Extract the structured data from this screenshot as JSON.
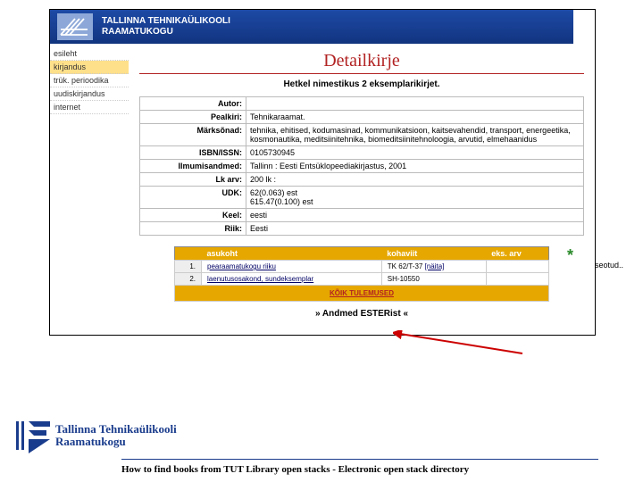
{
  "header": {
    "line1": "TALLINNA TEHNIKAÜLIKOOLI",
    "line2": "RAAMATUKOGU"
  },
  "nav": {
    "items": [
      {
        "label": "esileht",
        "hl": false
      },
      {
        "label": "kirjandus",
        "hl": true
      },
      {
        "label": "trük. perioodika",
        "hl": false
      },
      {
        "label": "uudiskirjandus",
        "hl": false
      },
      {
        "label": "internet",
        "hl": false
      }
    ]
  },
  "page": {
    "title": "Detailkirje",
    "subtitle": "Hetkel nimestikus 2 eksemplarikirjet."
  },
  "detail": {
    "rows": [
      {
        "label": "Autor:",
        "value": ""
      },
      {
        "label": "Pealkiri:",
        "value": "Tehnikaraamat."
      },
      {
        "label": "Märksõnad:",
        "value": "tehnika, ehitised, kodumasinad, kommunikatsioon, kaitsevahendid, transport, energeetika, kosmonautika, meditsiinitehnika, biomeditsiinitehnoloogia, arvutid, elmehaanidus"
      },
      {
        "label": "ISBN/ISSN:",
        "value": "0105730945"
      },
      {
        "label": "Ilmumisandmed:",
        "value": "Tallinn : Eesti Entsüklopeediakirjastus, 2001"
      },
      {
        "label": "Lk arv:",
        "value": "200 lk :"
      },
      {
        "label": "UDK:",
        "value": "62(0.063) est\n615.47(0.100) est"
      },
      {
        "label": "Keel:",
        "value": "eesti"
      },
      {
        "label": "Riik:",
        "value": "Eesti"
      }
    ]
  },
  "seotud": "seotud..",
  "loc": {
    "headers": [
      "",
      "asukoht",
      "kohaviit",
      "eks. arv"
    ],
    "rows": [
      {
        "n": "1.",
        "place": "pearaamatukogu riiku",
        "code": "TK 62/T-37",
        "link": "[näita]",
        "count": ""
      },
      {
        "n": "2.",
        "place": "laenutusosakond, sundeksemplar",
        "code": "SH-10550",
        "link": "",
        "count": ""
      }
    ],
    "button": "KÕIK TULEMUSED"
  },
  "ester": "» Andmed ESTERist «",
  "footer": {
    "line1": "Tallinna Tehnikaülikooli",
    "line2": "Raamatukogu"
  },
  "caption": "How to find books from TUT Library open stacks - Electronic open stack directory"
}
